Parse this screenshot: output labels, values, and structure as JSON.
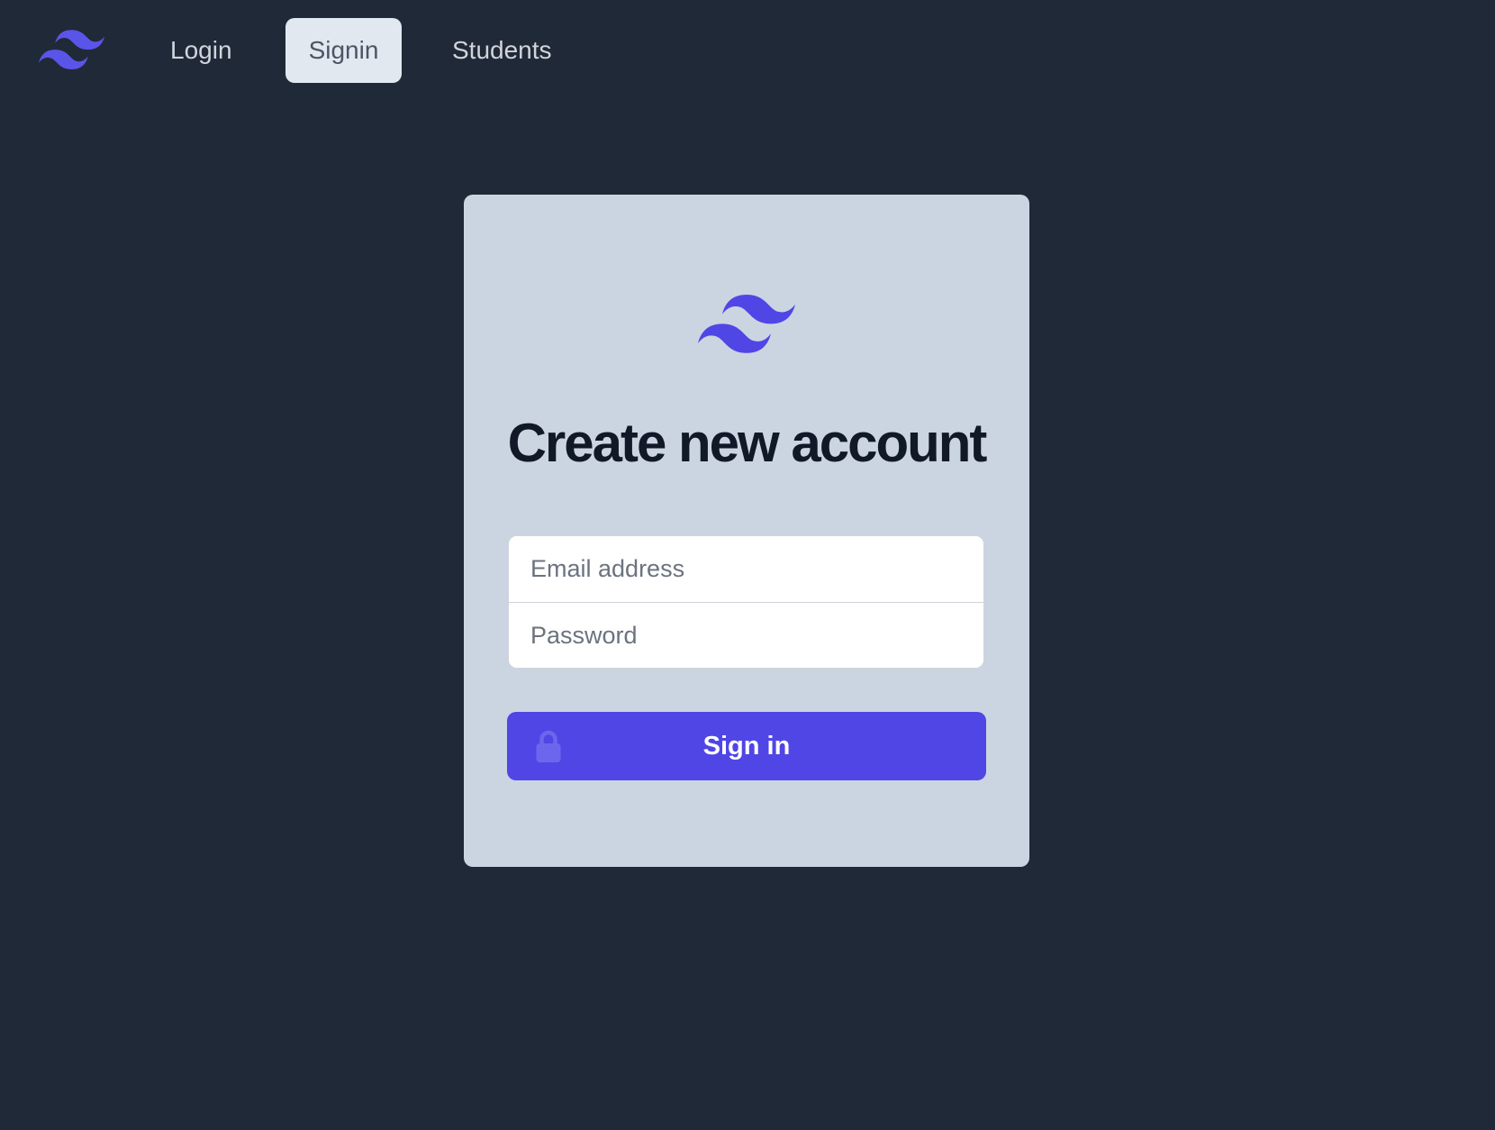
{
  "brand": {
    "logo_icon": "tailwind-logo-icon",
    "accent_color": "#4f46e5",
    "logo_color": "#5b54e8"
  },
  "nav": {
    "items": [
      {
        "label": "Login",
        "active": false
      },
      {
        "label": "Signin",
        "active": true
      },
      {
        "label": "Students",
        "active": false
      }
    ]
  },
  "form": {
    "title": "Create new account",
    "email": {
      "placeholder": "Email address",
      "value": ""
    },
    "password": {
      "placeholder": "Password",
      "value": ""
    },
    "submit": {
      "label": "Sign in",
      "icon": "lock-icon"
    }
  },
  "colors": {
    "page_background": "#1f2937",
    "card_background": "#cbd5e1",
    "active_nav_background": "#e2e8f0",
    "button_background": "#4f46e5"
  }
}
